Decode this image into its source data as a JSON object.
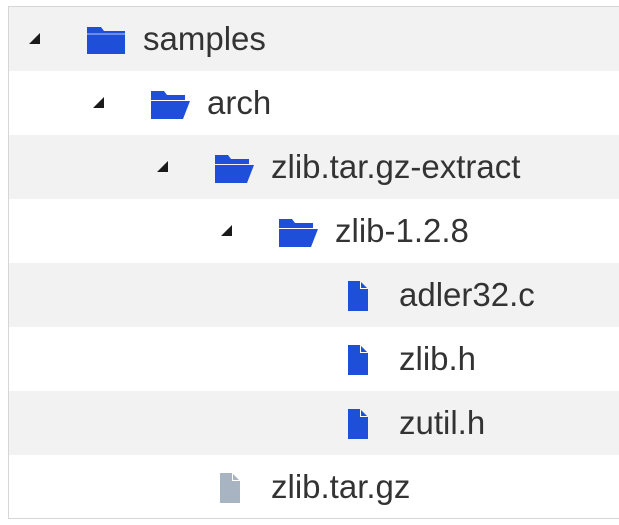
{
  "tree": {
    "nodes": [
      {
        "label": "samples",
        "kind": "folder-closed",
        "level": 0,
        "expanded": true
      },
      {
        "label": "arch",
        "kind": "folder-open",
        "level": 1,
        "expanded": true
      },
      {
        "label": "zlib.tar.gz-extract",
        "kind": "folder-open",
        "level": 2,
        "expanded": true
      },
      {
        "label": "zlib-1.2.8",
        "kind": "folder-open",
        "level": 3,
        "expanded": true
      },
      {
        "label": "adler32.c",
        "kind": "file",
        "level": 4
      },
      {
        "label": "zlib.h",
        "kind": "file",
        "level": 4
      },
      {
        "label": "zutil.h",
        "kind": "file",
        "level": 4
      },
      {
        "label": "zlib.tar.gz",
        "kind": "file-gray",
        "level": 2
      }
    ]
  },
  "colors": {
    "folder": "#1e4fd8",
    "file": "#1e4fd8",
    "file_gray": "#a9b4c2",
    "row_alt": "#f2f2f2",
    "text": "#333333"
  }
}
